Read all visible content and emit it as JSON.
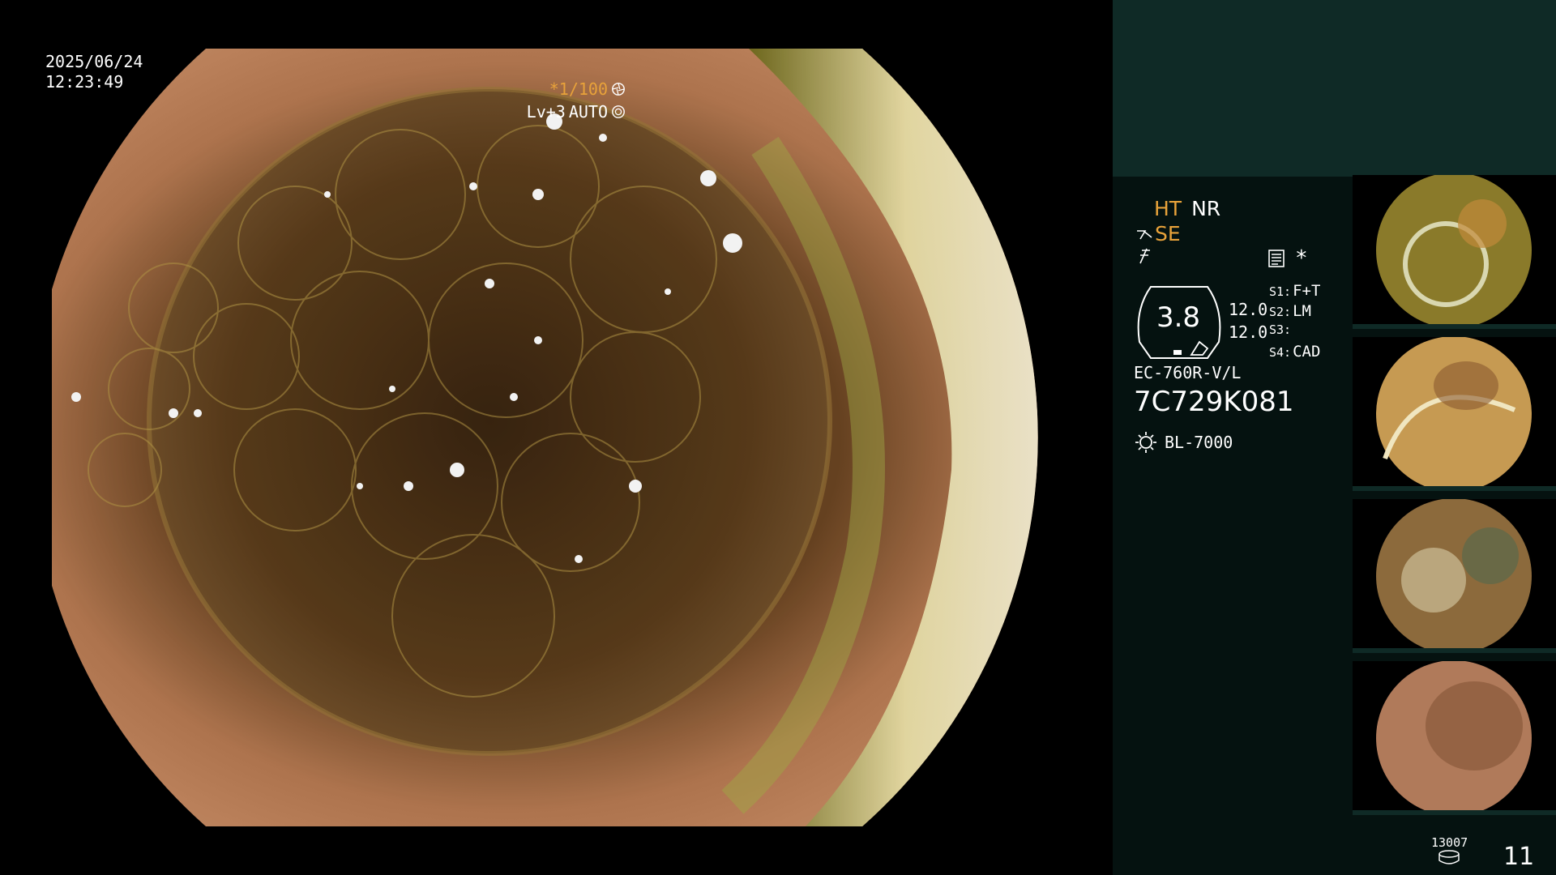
{
  "overlay": {
    "date": "2025/06/24",
    "time": "12:23:49",
    "exposure": "*1/100",
    "level": "Lv+3",
    "iris_mode": "AUTO"
  },
  "panel": {
    "mode_ht": "HT",
    "mode_nr": "NR",
    "mode_se": "SE",
    "gauge_value": "3.8",
    "scale_1": "12.0",
    "scale_2": "12.0",
    "asterisk": "*",
    "slots": [
      {
        "key": "S1:",
        "value": "F+T"
      },
      {
        "key": "S2:",
        "value": "LM"
      },
      {
        "key": "S3:",
        "value": ""
      },
      {
        "key": "S4:",
        "value": "CAD"
      }
    ],
    "scope_model": "EC-760R-V/L",
    "serial": "7C729K081",
    "light_source": "BL-7000",
    "storage_count": "13007",
    "page_number": "11"
  },
  "icons": {
    "exposure_icon": "aperture-icon",
    "iris_icon": "iris-icon",
    "structure_icon": "structure-enhance-icon",
    "color_icon": "color-enhance-icon",
    "settings_icon": "settings-sheet-icon",
    "light_icon": "sun-icon",
    "storage_icon": "storage-disk-icon"
  },
  "colors": {
    "accent_orange": "#e8a23a",
    "panel_top": "#0f2a26",
    "panel_body": "#051210"
  }
}
